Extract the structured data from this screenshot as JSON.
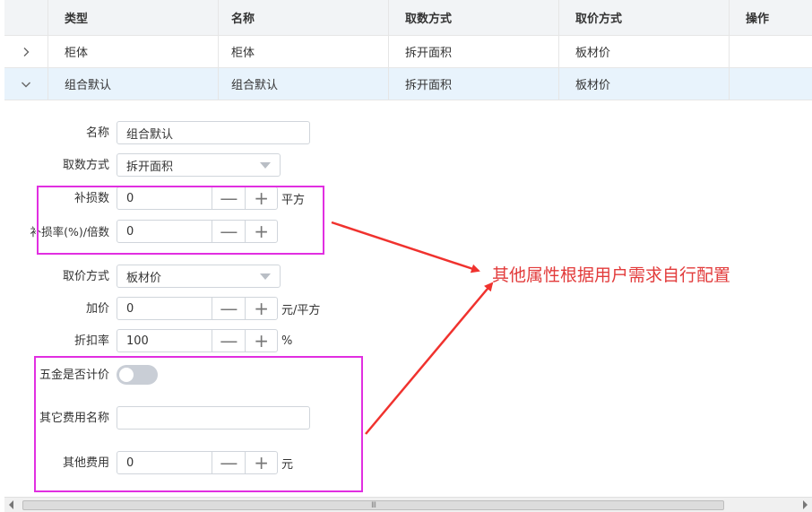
{
  "table": {
    "headers": [
      "类型",
      "名称",
      "取数方式",
      "取价方式",
      "操作"
    ],
    "rows": [
      {
        "type": "柜体",
        "name": "柜体",
        "qty_method": "拆开面积",
        "price_method": "板材价",
        "expanded": false
      },
      {
        "type": "组合默认",
        "name": "组合默认",
        "qty_method": "拆开面积",
        "price_method": "板材价",
        "expanded": true
      }
    ]
  },
  "form": {
    "name": {
      "label": "名称",
      "value": "组合默认"
    },
    "qty_method": {
      "label": "取数方式",
      "value": "拆开面积"
    },
    "loss_count": {
      "label": "补损数",
      "value": "0",
      "unit": "平方"
    },
    "loss_rate": {
      "label": "补损率(%)/倍数",
      "value": "0"
    },
    "price_method": {
      "label": "取价方式",
      "value": "板材价"
    },
    "markup": {
      "label": "加价",
      "value": "0",
      "unit": "元/平方"
    },
    "discount": {
      "label": "折扣率",
      "value": "100",
      "unit": "%"
    },
    "hardware_priced": {
      "label": "五金是否计价",
      "value": false
    },
    "other_fee_name": {
      "label": "其它费用名称",
      "value": ""
    },
    "other_fee": {
      "label": "其他费用",
      "value": "0",
      "unit": "元"
    }
  },
  "stepper": {
    "minus": "—",
    "plus": "+"
  },
  "annotation": {
    "text": "其他属性根据用户需求自行配置",
    "color": "#e23b3b",
    "box_color": "#e12fe1"
  },
  "scrollbar": {
    "grip": "III"
  }
}
